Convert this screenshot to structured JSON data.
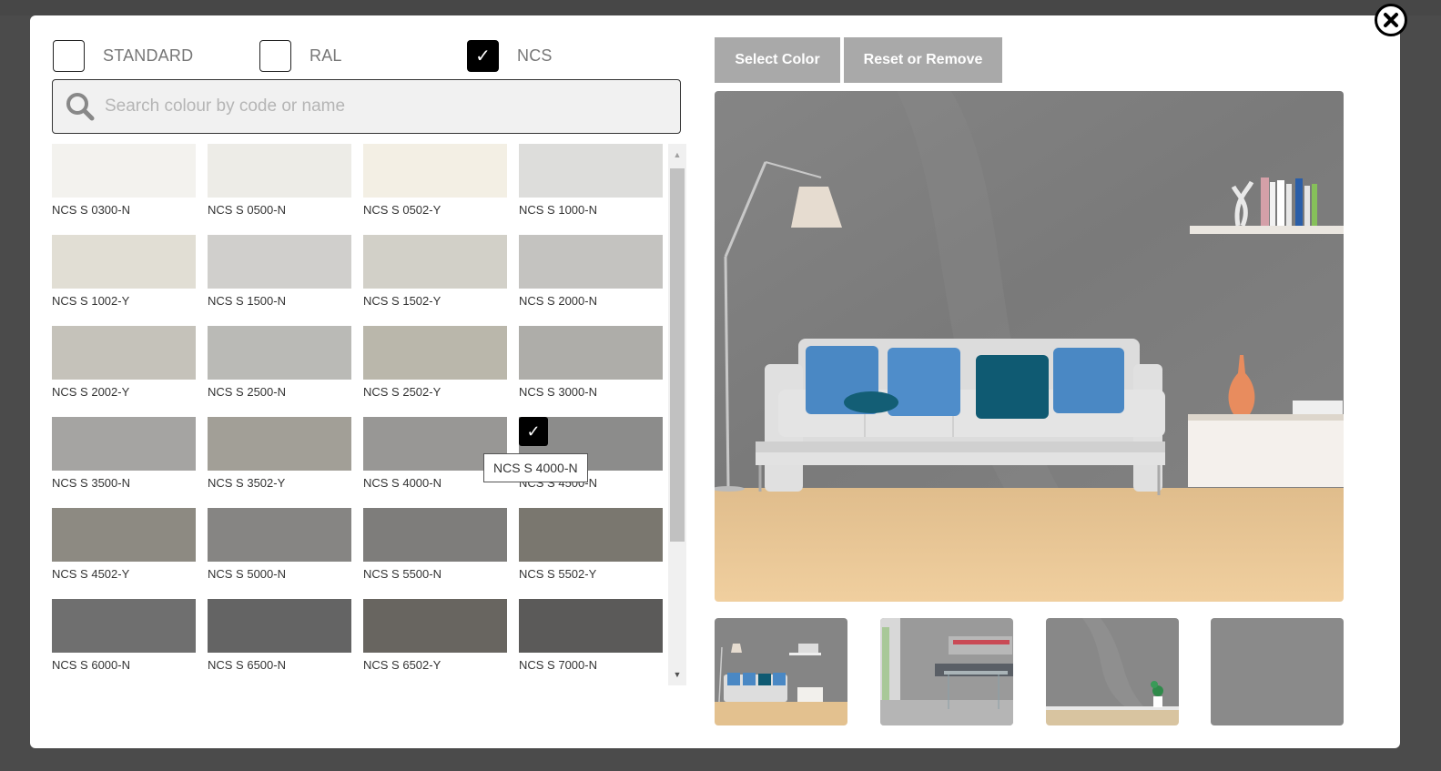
{
  "standards": [
    {
      "label": "STANDARD",
      "checked": false
    },
    {
      "label": "RAL",
      "checked": false
    },
    {
      "label": "NCS",
      "checked": true
    }
  ],
  "search": {
    "placeholder": "Search colour by code or name",
    "value": ""
  },
  "swatches": [
    {
      "label": "NCS S 0300-N",
      "color": "#f3f2ee"
    },
    {
      "label": "NCS S 0500-N",
      "color": "#edece7"
    },
    {
      "label": "NCS S 0502-Y",
      "color": "#f3efe4"
    },
    {
      "label": "NCS S 1000-N",
      "color": "#dddddb"
    },
    {
      "label": "NCS S 1002-Y",
      "color": "#e1ded4"
    },
    {
      "label": "NCS S 1500-N",
      "color": "#d0cfcc"
    },
    {
      "label": "NCS S 1502-Y",
      "color": "#d2d0c8"
    },
    {
      "label": "NCS S 2000-N",
      "color": "#c4c3c0"
    },
    {
      "label": "NCS S 2002-Y",
      "color": "#c5c2ba"
    },
    {
      "label": "NCS S 2500-N",
      "color": "#babab6"
    },
    {
      "label": "NCS S 2502-Y",
      "color": "#bab7ab"
    },
    {
      "label": "NCS S 3000-N",
      "color": "#aeada9"
    },
    {
      "label": "NCS S 3500-N",
      "color": "#a5a4a2"
    },
    {
      "label": "NCS S 3502-Y",
      "color": "#a29f97"
    },
    {
      "label": "NCS S 4000-N",
      "color": "#989795"
    },
    {
      "label": "NCS S 4500-N",
      "color": "#8c8c8b",
      "selected": true
    },
    {
      "label": "NCS S 4502-Y",
      "color": "#8d8a82"
    },
    {
      "label": "NCS S 5000-N",
      "color": "#868583"
    },
    {
      "label": "NCS S 5500-N",
      "color": "#7e7d7b"
    },
    {
      "label": "NCS S 5502-Y",
      "color": "#7a776f"
    },
    {
      "label": "NCS S 6000-N",
      "color": "#6f6f6f"
    },
    {
      "label": "NCS S 6500-N",
      "color": "#646464"
    },
    {
      "label": "NCS S 6502-Y",
      "color": "#686560"
    },
    {
      "label": "NCS S 7000-N",
      "color": "#5b5a59"
    }
  ],
  "tooltip": {
    "text": "NCS S 4000-N"
  },
  "icons": {
    "checkmark": "✓",
    "scroll_up": "▲",
    "scroll_down": "▼"
  },
  "actions": {
    "select_label": "Select Color",
    "reset_label": "Reset or Remove"
  },
  "preview": {
    "wall_color": "#7d7d7d",
    "floor_color": "#e9c594"
  },
  "thumbnails": [
    {
      "scene": "living-room-sofa",
      "active": true
    },
    {
      "scene": "dining-room-window",
      "active": false
    },
    {
      "scene": "empty-room-plant",
      "active": false
    },
    {
      "scene": "plain-color",
      "active": false,
      "color": "#8a8a8a"
    }
  ]
}
